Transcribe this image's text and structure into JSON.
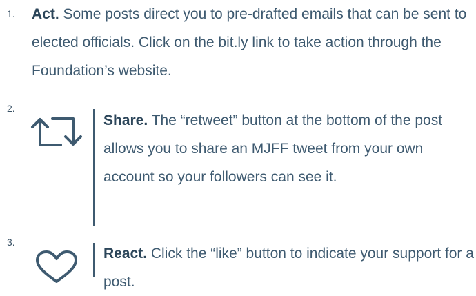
{
  "items": [
    {
      "number": "1.",
      "heading": "Act.",
      "text": " Some posts direct you to pre-drafted emails that can be sent to elected officials. Click on the bit.ly link to take action through the Foundation’s website."
    },
    {
      "number": "2.",
      "icon": "retweet-icon",
      "heading": "Share.",
      "text": " The “retweet” button at the bottom of the post allows you to share an MJFF tweet from your own account so your followers can see it."
    },
    {
      "number": "3.",
      "icon": "heart-icon",
      "heading": "React.",
      "text": " Click the “like” button to indicate your support for a post."
    }
  ],
  "colors": {
    "text": "#3e5a70",
    "heading": "#2c465a",
    "icon": "#3e5a70"
  }
}
